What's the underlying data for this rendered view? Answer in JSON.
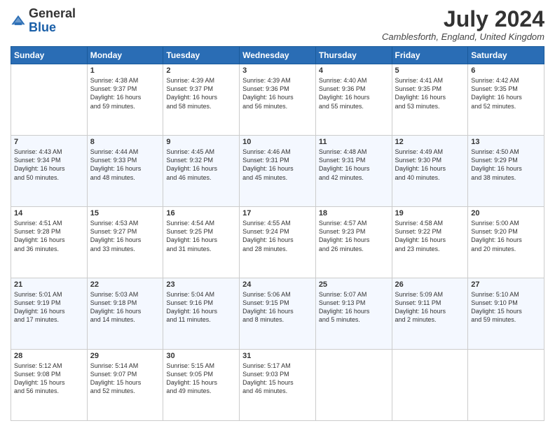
{
  "header": {
    "logo": {
      "general": "General",
      "blue": "Blue"
    },
    "title": "July 2024",
    "location": "Camblesforth, England, United Kingdom"
  },
  "days_of_week": [
    "Sunday",
    "Monday",
    "Tuesday",
    "Wednesday",
    "Thursday",
    "Friday",
    "Saturday"
  ],
  "weeks": [
    [
      {
        "day": "",
        "info": ""
      },
      {
        "day": "1",
        "info": "Sunrise: 4:38 AM\nSunset: 9:37 PM\nDaylight: 16 hours\nand 59 minutes."
      },
      {
        "day": "2",
        "info": "Sunrise: 4:39 AM\nSunset: 9:37 PM\nDaylight: 16 hours\nand 58 minutes."
      },
      {
        "day": "3",
        "info": "Sunrise: 4:39 AM\nSunset: 9:36 PM\nDaylight: 16 hours\nand 56 minutes."
      },
      {
        "day": "4",
        "info": "Sunrise: 4:40 AM\nSunset: 9:36 PM\nDaylight: 16 hours\nand 55 minutes."
      },
      {
        "day": "5",
        "info": "Sunrise: 4:41 AM\nSunset: 9:35 PM\nDaylight: 16 hours\nand 53 minutes."
      },
      {
        "day": "6",
        "info": "Sunrise: 4:42 AM\nSunset: 9:35 PM\nDaylight: 16 hours\nand 52 minutes."
      }
    ],
    [
      {
        "day": "7",
        "info": "Sunrise: 4:43 AM\nSunset: 9:34 PM\nDaylight: 16 hours\nand 50 minutes."
      },
      {
        "day": "8",
        "info": "Sunrise: 4:44 AM\nSunset: 9:33 PM\nDaylight: 16 hours\nand 48 minutes."
      },
      {
        "day": "9",
        "info": "Sunrise: 4:45 AM\nSunset: 9:32 PM\nDaylight: 16 hours\nand 46 minutes."
      },
      {
        "day": "10",
        "info": "Sunrise: 4:46 AM\nSunset: 9:31 PM\nDaylight: 16 hours\nand 45 minutes."
      },
      {
        "day": "11",
        "info": "Sunrise: 4:48 AM\nSunset: 9:31 PM\nDaylight: 16 hours\nand 42 minutes."
      },
      {
        "day": "12",
        "info": "Sunrise: 4:49 AM\nSunset: 9:30 PM\nDaylight: 16 hours\nand 40 minutes."
      },
      {
        "day": "13",
        "info": "Sunrise: 4:50 AM\nSunset: 9:29 PM\nDaylight: 16 hours\nand 38 minutes."
      }
    ],
    [
      {
        "day": "14",
        "info": "Sunrise: 4:51 AM\nSunset: 9:28 PM\nDaylight: 16 hours\nand 36 minutes."
      },
      {
        "day": "15",
        "info": "Sunrise: 4:53 AM\nSunset: 9:27 PM\nDaylight: 16 hours\nand 33 minutes."
      },
      {
        "day": "16",
        "info": "Sunrise: 4:54 AM\nSunset: 9:25 PM\nDaylight: 16 hours\nand 31 minutes."
      },
      {
        "day": "17",
        "info": "Sunrise: 4:55 AM\nSunset: 9:24 PM\nDaylight: 16 hours\nand 28 minutes."
      },
      {
        "day": "18",
        "info": "Sunrise: 4:57 AM\nSunset: 9:23 PM\nDaylight: 16 hours\nand 26 minutes."
      },
      {
        "day": "19",
        "info": "Sunrise: 4:58 AM\nSunset: 9:22 PM\nDaylight: 16 hours\nand 23 minutes."
      },
      {
        "day": "20",
        "info": "Sunrise: 5:00 AM\nSunset: 9:20 PM\nDaylight: 16 hours\nand 20 minutes."
      }
    ],
    [
      {
        "day": "21",
        "info": "Sunrise: 5:01 AM\nSunset: 9:19 PM\nDaylight: 16 hours\nand 17 minutes."
      },
      {
        "day": "22",
        "info": "Sunrise: 5:03 AM\nSunset: 9:18 PM\nDaylight: 16 hours\nand 14 minutes."
      },
      {
        "day": "23",
        "info": "Sunrise: 5:04 AM\nSunset: 9:16 PM\nDaylight: 16 hours\nand 11 minutes."
      },
      {
        "day": "24",
        "info": "Sunrise: 5:06 AM\nSunset: 9:15 PM\nDaylight: 16 hours\nand 8 minutes."
      },
      {
        "day": "25",
        "info": "Sunrise: 5:07 AM\nSunset: 9:13 PM\nDaylight: 16 hours\nand 5 minutes."
      },
      {
        "day": "26",
        "info": "Sunrise: 5:09 AM\nSunset: 9:11 PM\nDaylight: 16 hours\nand 2 minutes."
      },
      {
        "day": "27",
        "info": "Sunrise: 5:10 AM\nSunset: 9:10 PM\nDaylight: 15 hours\nand 59 minutes."
      }
    ],
    [
      {
        "day": "28",
        "info": "Sunrise: 5:12 AM\nSunset: 9:08 PM\nDaylight: 15 hours\nand 56 minutes."
      },
      {
        "day": "29",
        "info": "Sunrise: 5:14 AM\nSunset: 9:07 PM\nDaylight: 15 hours\nand 52 minutes."
      },
      {
        "day": "30",
        "info": "Sunrise: 5:15 AM\nSunset: 9:05 PM\nDaylight: 15 hours\nand 49 minutes."
      },
      {
        "day": "31",
        "info": "Sunrise: 5:17 AM\nSunset: 9:03 PM\nDaylight: 15 hours\nand 46 minutes."
      },
      {
        "day": "",
        "info": ""
      },
      {
        "day": "",
        "info": ""
      },
      {
        "day": "",
        "info": ""
      }
    ]
  ]
}
